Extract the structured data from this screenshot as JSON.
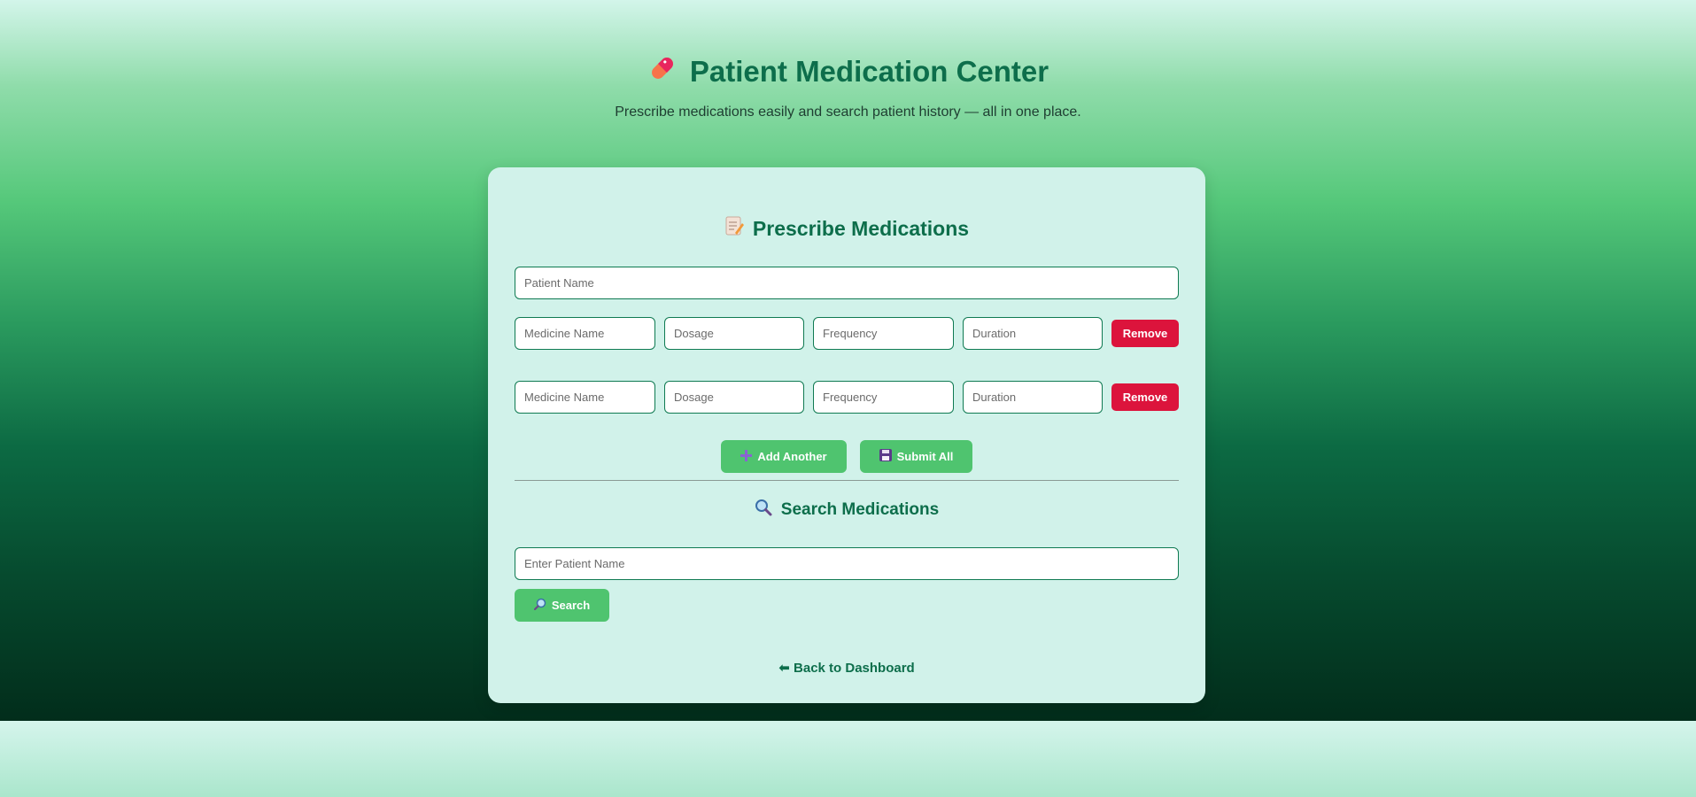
{
  "header": {
    "title_icon": "pill-icon",
    "title": "Patient Medication Center",
    "subtitle": "Prescribe medications easily and search patient history — all in one place."
  },
  "prescribe": {
    "title_icon": "memo-icon",
    "title": "Prescribe Medications",
    "patient_placeholder": "Patient Name",
    "rows": [
      {
        "medicine": "Medicine Name",
        "dosage": "Dosage",
        "frequency": "Frequency",
        "duration": "Duration",
        "remove_label": "Remove"
      },
      {
        "medicine": "Medicine Name",
        "dosage": "Dosage",
        "frequency": "Frequency",
        "duration": "Duration",
        "remove_label": "Remove"
      }
    ],
    "add_icon": "plus-icon",
    "add_label": "Add Another",
    "submit_icon": "floppy-disk-icon",
    "submit_label": "Submit All"
  },
  "search": {
    "title_icon": "magnifier-icon",
    "title": "Search Medications",
    "input_placeholder": "Enter Patient Name",
    "button_icon": "magnifier-icon",
    "button_label": "Search"
  },
  "back_link": {
    "icon": "left-arrow-icon",
    "label": "Back to Dashboard"
  },
  "colors": {
    "accent": "#0d6e4b",
    "button_green": "#4fc46f",
    "remove_red": "#dc143c",
    "card_bg": "#d1f2ea"
  }
}
